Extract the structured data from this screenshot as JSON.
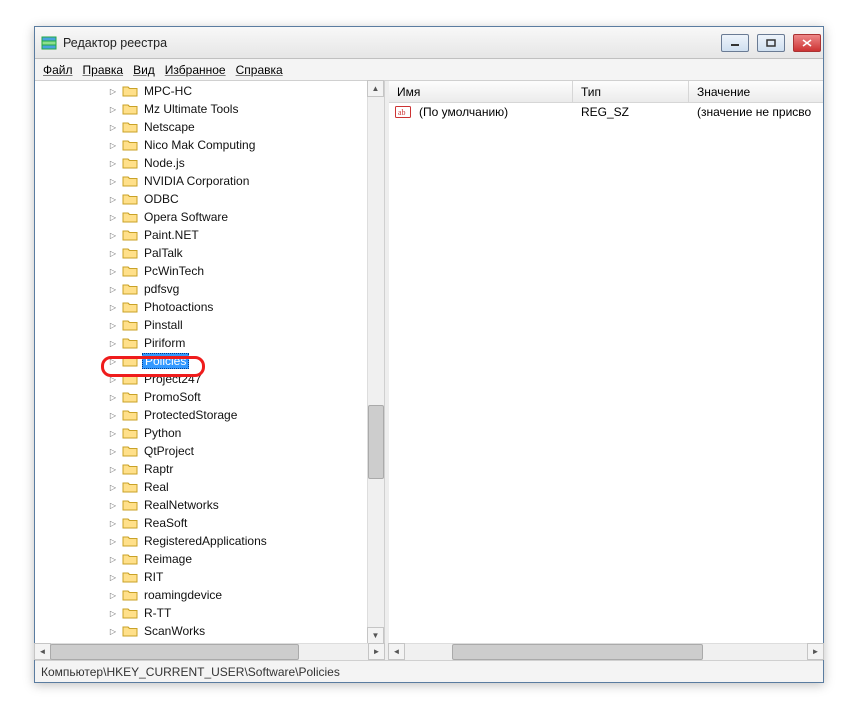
{
  "window": {
    "title": "Редактор реестра"
  },
  "menu": {
    "file": "Файл",
    "edit": "Правка",
    "view": "Вид",
    "favorites": "Избранное",
    "help": "Справка"
  },
  "tree": {
    "indent": 72,
    "items": [
      {
        "label": "MPC-HC",
        "expandable": true,
        "selected": false
      },
      {
        "label": "Mz Ultimate Tools",
        "expandable": true,
        "selected": false
      },
      {
        "label": "Netscape",
        "expandable": true,
        "selected": false
      },
      {
        "label": "Nico Mak Computing",
        "expandable": true,
        "selected": false
      },
      {
        "label": "Node.js",
        "expandable": true,
        "selected": false
      },
      {
        "label": "NVIDIA Corporation",
        "expandable": true,
        "selected": false
      },
      {
        "label": "ODBC",
        "expandable": true,
        "selected": false
      },
      {
        "label": "Opera Software",
        "expandable": true,
        "selected": false
      },
      {
        "label": "Paint.NET",
        "expandable": true,
        "selected": false
      },
      {
        "label": "PalTalk",
        "expandable": true,
        "selected": false
      },
      {
        "label": "PcWinTech",
        "expandable": true,
        "selected": false
      },
      {
        "label": "pdfsvg",
        "expandable": true,
        "selected": false
      },
      {
        "label": "Photoactions",
        "expandable": true,
        "selected": false
      },
      {
        "label": "Pinstall",
        "expandable": true,
        "selected": false
      },
      {
        "label": "Piriform",
        "expandable": true,
        "selected": false
      },
      {
        "label": "Policies",
        "expandable": true,
        "selected": true
      },
      {
        "label": "Project247",
        "expandable": true,
        "selected": false
      },
      {
        "label": "PromoSoft",
        "expandable": true,
        "selected": false
      },
      {
        "label": "ProtectedStorage",
        "expandable": true,
        "selected": false
      },
      {
        "label": "Python",
        "expandable": true,
        "selected": false
      },
      {
        "label": "QtProject",
        "expandable": true,
        "selected": false
      },
      {
        "label": "Raptr",
        "expandable": true,
        "selected": false
      },
      {
        "label": "Real",
        "expandable": true,
        "selected": false
      },
      {
        "label": "RealNetworks",
        "expandable": true,
        "selected": false
      },
      {
        "label": "ReaSoft",
        "expandable": true,
        "selected": false
      },
      {
        "label": "RegisteredApplications",
        "expandable": true,
        "selected": false
      },
      {
        "label": "Reimage",
        "expandable": true,
        "selected": false
      },
      {
        "label": "RIT",
        "expandable": true,
        "selected": false
      },
      {
        "label": "roamingdevice",
        "expandable": true,
        "selected": false
      },
      {
        "label": "R-TT",
        "expandable": true,
        "selected": false
      },
      {
        "label": "ScanWorks",
        "expandable": true,
        "selected": false
      }
    ]
  },
  "list": {
    "columns": {
      "name": "Имя",
      "type": "Тип",
      "value": "Значение"
    },
    "rows": [
      {
        "name": "(По умолчанию)",
        "type": "REG_SZ",
        "value": "(значение не присво"
      }
    ]
  },
  "status": {
    "path": "Компьютер\\HKEY_CURRENT_USER\\Software\\Policies"
  }
}
